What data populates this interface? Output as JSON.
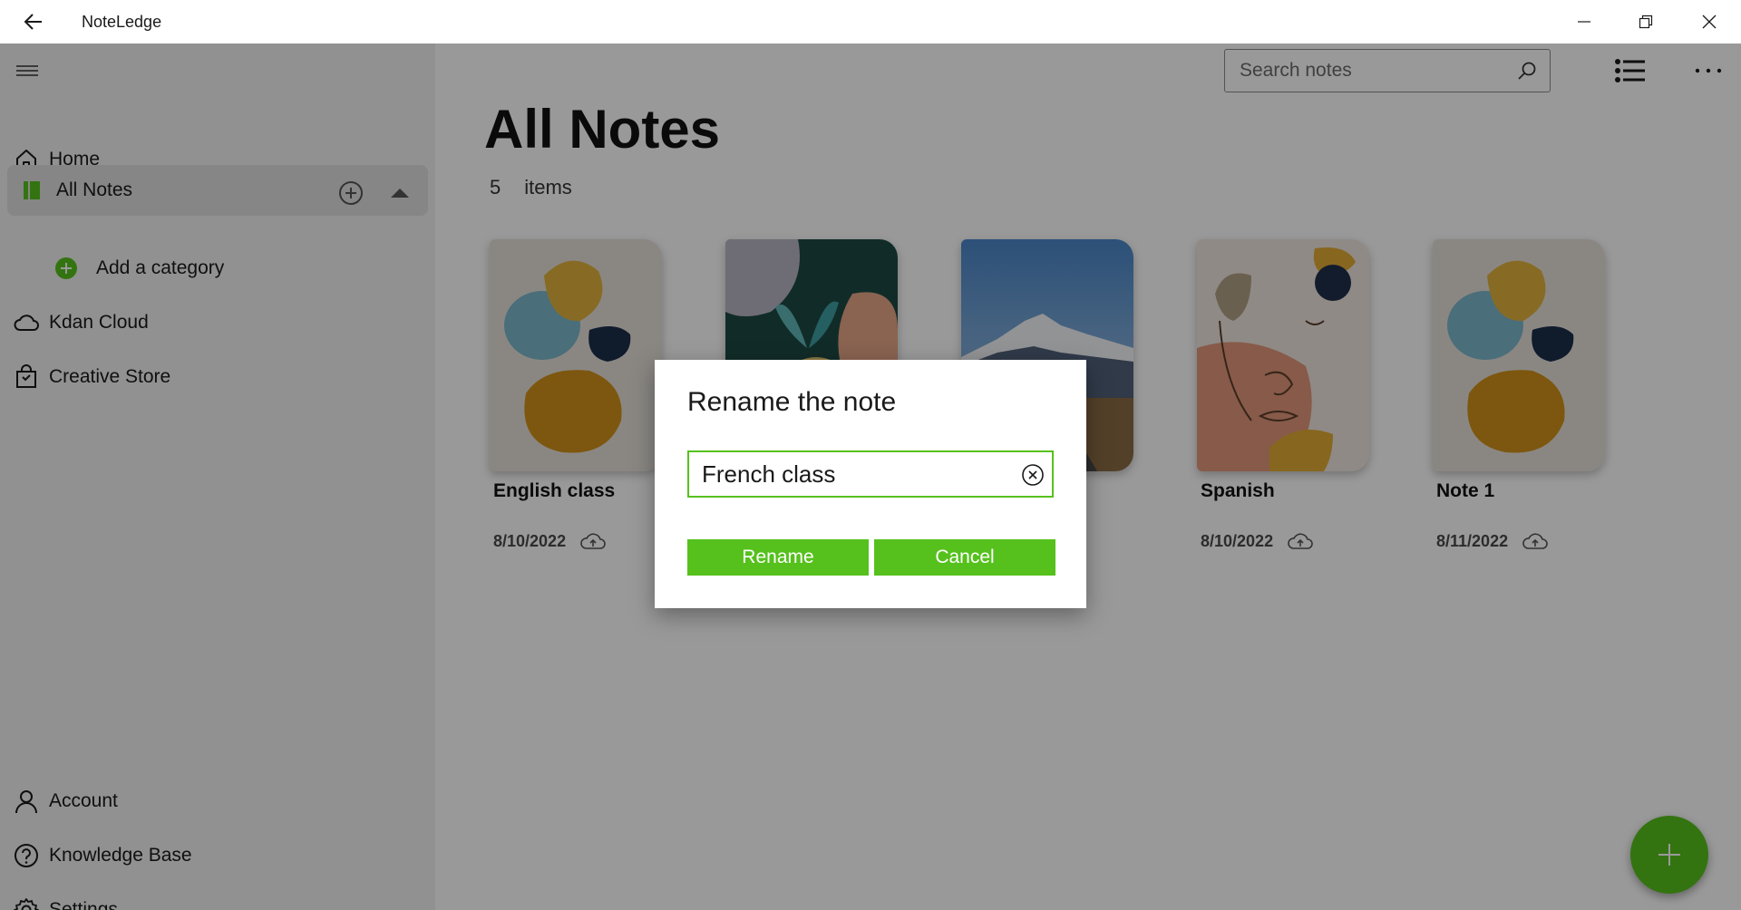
{
  "titlebar": {
    "title": "NoteLedge"
  },
  "sidebar": {
    "home": "Home",
    "all_notes": "All Notes",
    "add_category": "Add a category",
    "kdan_cloud": "Kdan Cloud",
    "creative_store": "Creative Store",
    "account": "Account",
    "knowledge_base": "Knowledge Base",
    "settings": "Settings"
  },
  "header": {
    "search_placeholder": "Search notes"
  },
  "main": {
    "title": "All Notes",
    "count": "5",
    "count_label": "items",
    "notes": [
      {
        "title": "English class",
        "date": "8/10/2022",
        "cover": "abstract-shapes"
      },
      {
        "title": "",
        "date": "",
        "cover": "leaf-sprout"
      },
      {
        "title": "",
        "date": "",
        "cover": "mountain-road"
      },
      {
        "title": "Spanish",
        "date": "8/10/2022",
        "cover": "line-face"
      },
      {
        "title": "Note 1",
        "date": "8/11/2022",
        "cover": "abstract-shapes"
      }
    ]
  },
  "dialog": {
    "title": "Rename the note",
    "input_value": "French class",
    "rename_label": "Rename",
    "cancel_label": "Cancel"
  },
  "colors": {
    "accent": "#56c11d",
    "overlay": "rgba(0,0,0,0.40)"
  }
}
